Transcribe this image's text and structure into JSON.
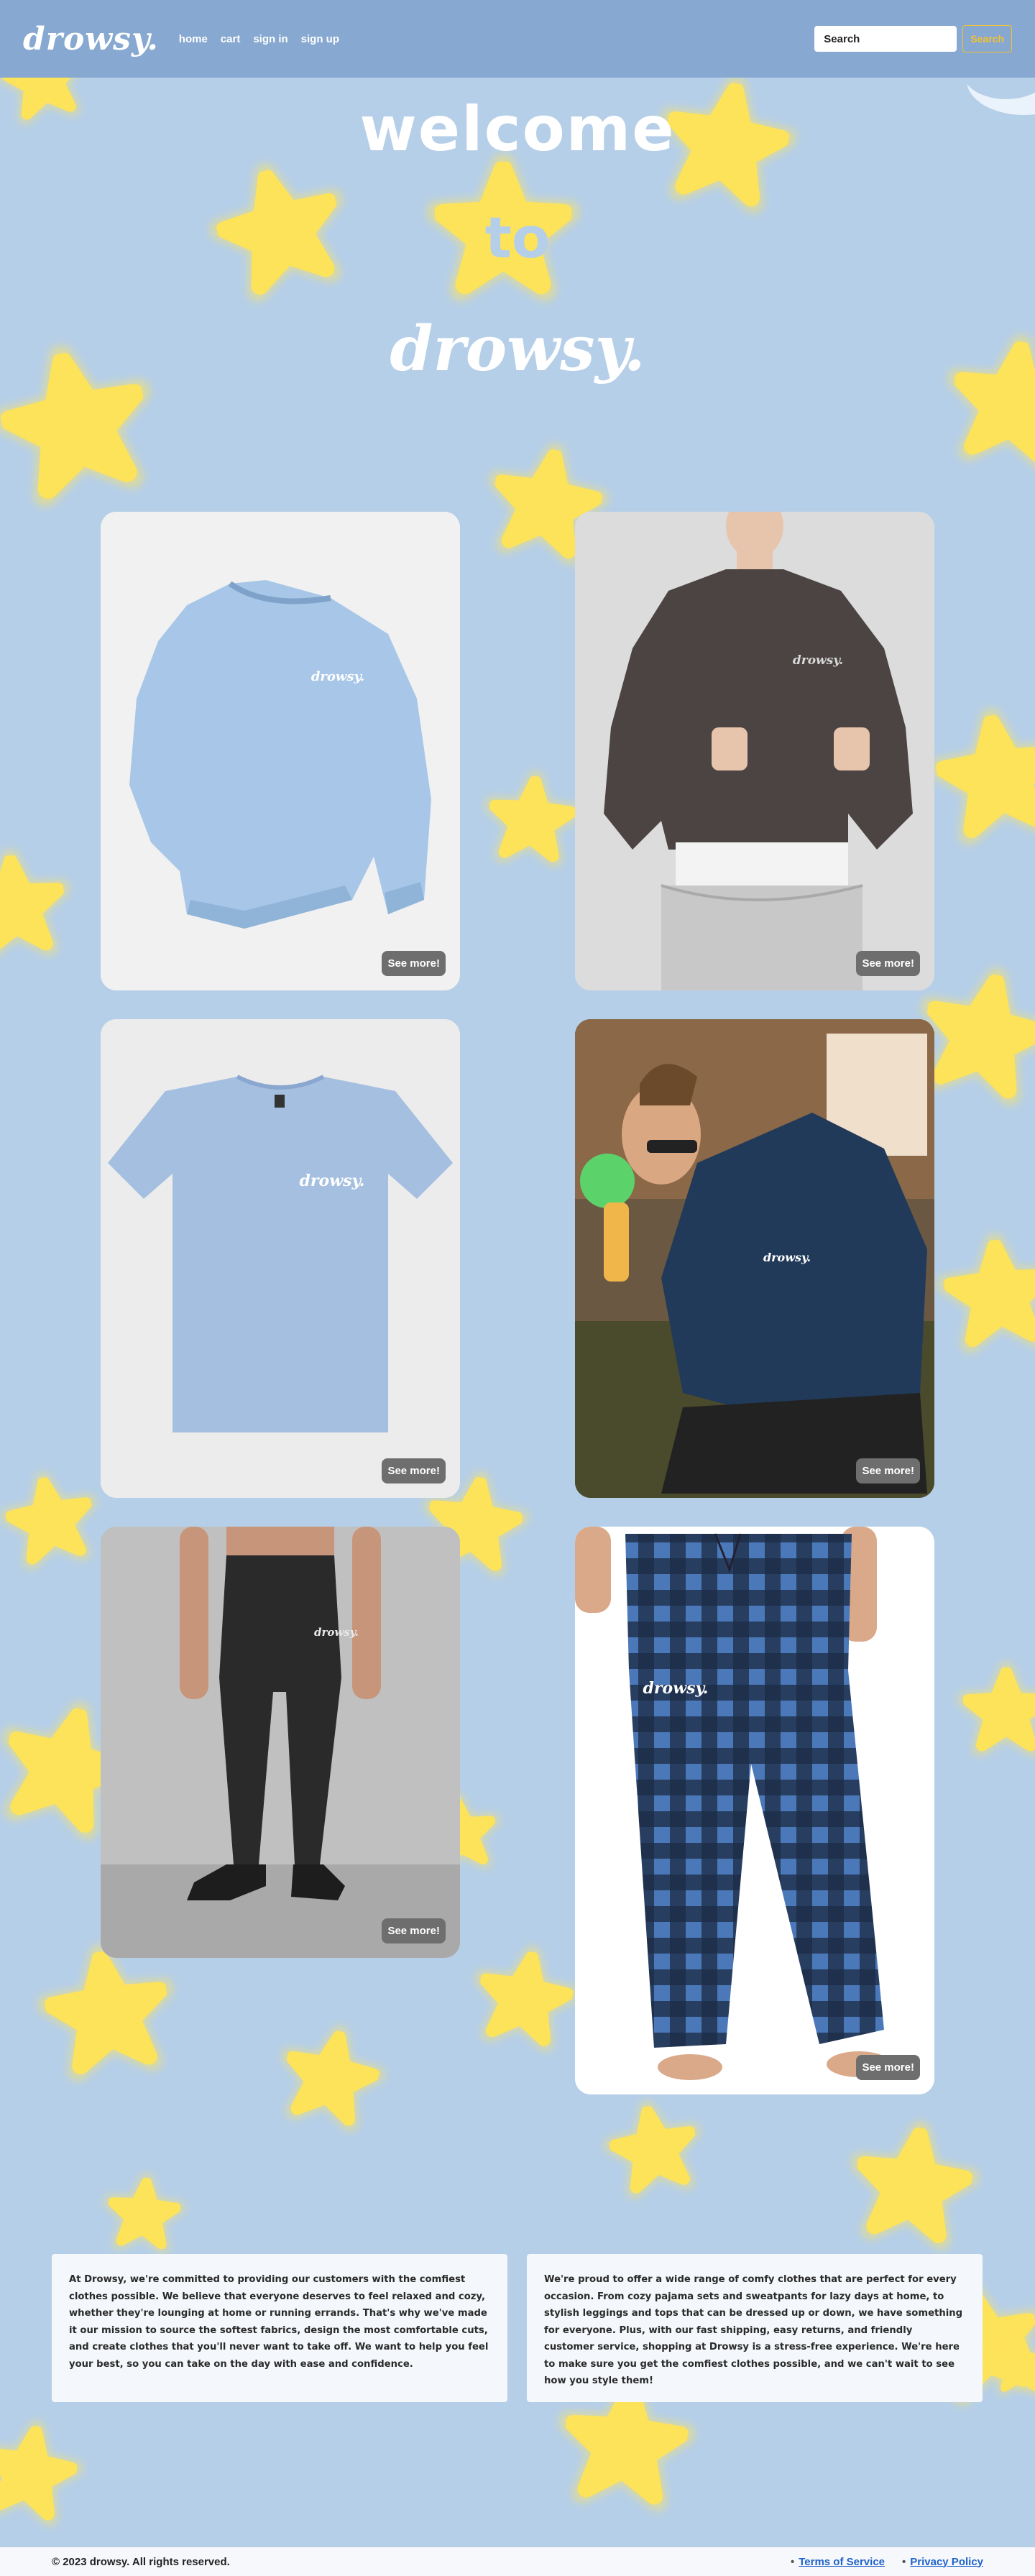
{
  "nav": {
    "logo": "drowsy.",
    "links": [
      "home",
      "cart",
      "sign in",
      "sign up"
    ],
    "search_placeholder": "Search",
    "search_button": "Search"
  },
  "hero": {
    "line1": "welcome",
    "line2": "to",
    "line3": "drowsy."
  },
  "products": [
    {
      "name": "light blue crewneck sweatshirt",
      "print": "drowsy.",
      "button": "See more!"
    },
    {
      "name": "charcoal oversized sweatshirt",
      "print": "drowsy.",
      "button": "See more!"
    },
    {
      "name": "light blue t-shirt",
      "print": "drowsy.",
      "button": "See more!"
    },
    {
      "name": "navy hoodie",
      "print": "drowsy.",
      "button": "See more!"
    },
    {
      "name": "black leggings",
      "print": "drowsy.",
      "button": "See more!"
    },
    {
      "name": "blue plaid pajama pants",
      "print": "drowsy.",
      "button": "See more!"
    }
  ],
  "about": {
    "left": "At Drowsy, we're committed to providing our customers with the comfiest clothes possible. We believe that everyone deserves to feel relaxed and cozy, whether they're lounging at home or running errands. That's why we've made it our mission to source the softest fabrics, design the most comfortable cuts, and create clothes that you'll never want to take off. We want to help you feel your best, so you can take on the day with ease and confidence.",
    "right": "We're proud to offer a wide range of comfy clothes that are perfect for every occasion. From cozy pajama sets and sweatpants for lazy days at home, to stylish leggings and tops that can be dressed up or down, we have something for everyone. Plus, with our fast shipping, easy returns, and friendly customer service, shopping at Drowsy is a stress-free experience. We're here to make sure you get the comfiest clothes possible, and we can't wait to see how you style them!"
  },
  "footer": {
    "copyright": "© 2023 drowsy. All rights reserved.",
    "terms": "Terms of Service",
    "privacy": "Privacy Policy"
  },
  "colors": {
    "background": "#b6cfe8",
    "nav": "#87a8d0",
    "star": "#fde35a",
    "accent": "#f2c230",
    "link": "#1f62c9"
  },
  "icons": {
    "stars": "star-icon",
    "moon": "moon-icon"
  }
}
